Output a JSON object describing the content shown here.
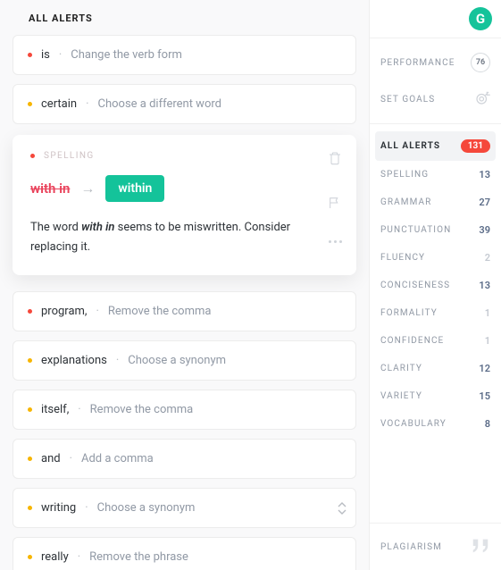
{
  "section_title": "ALL ALERTS",
  "alerts": [
    {
      "dot": "red",
      "word": "is",
      "sep": "·",
      "action": "Change the verb form"
    },
    {
      "dot": "yellow",
      "word": "certain",
      "sep": "·",
      "action": "Choose a different word"
    }
  ],
  "expanded": {
    "dot": "red",
    "tag": "SPELLING",
    "wrong": "with in",
    "right": "within",
    "desc_pre": "The word ",
    "desc_em": "with in",
    "desc_post": " seems to be miswritten. Consider replacing it."
  },
  "alerts2": [
    {
      "dot": "red",
      "word": "program,",
      "sep": "·",
      "action": "Remove the comma"
    },
    {
      "dot": "yellow",
      "word": "explanations",
      "sep": "·",
      "action": "Choose a synonym"
    },
    {
      "dot": "yellow",
      "word": "itself,",
      "sep": "·",
      "action": "Remove the comma"
    },
    {
      "dot": "yellow",
      "word": "and",
      "sep": "·",
      "action": "Add a comma"
    },
    {
      "dot": "yellow",
      "word": "writing",
      "sep": "·",
      "action": "Choose a synonym",
      "nav": true
    },
    {
      "dot": "yellow",
      "word": "really",
      "sep": "·",
      "action": "Remove the phrase"
    }
  ],
  "sidebar": {
    "performance": {
      "label": "PERFORMANCE",
      "score": "76"
    },
    "goals": {
      "label": "SET GOALS"
    },
    "all_alerts": {
      "label": "ALL ALERTS",
      "count": "131"
    },
    "categories": [
      {
        "label": "SPELLING",
        "count": "13"
      },
      {
        "label": "GRAMMAR",
        "count": "27"
      },
      {
        "label": "PUNCTUATION",
        "count": "39"
      },
      {
        "label": "FLUENCY",
        "count": "2",
        "faded": true
      },
      {
        "label": "CONCISENESS",
        "count": "13"
      },
      {
        "label": "FORMALITY",
        "count": "1",
        "faded": true
      },
      {
        "label": "CONFIDENCE",
        "count": "1",
        "faded": true
      },
      {
        "label": "CLARITY",
        "count": "12"
      },
      {
        "label": "VARIETY",
        "count": "15"
      },
      {
        "label": "VOCABULARY",
        "count": "8"
      }
    ],
    "plagiarism": {
      "label": "PLAGIARISM"
    }
  }
}
